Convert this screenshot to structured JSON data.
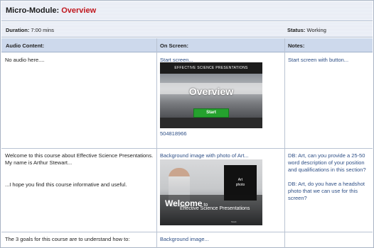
{
  "header": {
    "title_prefix": "Micro-Module: ",
    "title_highlight": "Overview",
    "duration_label": "Duration:",
    "duration_value": " 7:00 mins",
    "status_label": "Status:",
    "status_value": " Working"
  },
  "columns": {
    "audio": "Audio Content:",
    "screen": "On Screen:",
    "notes": "Notes:"
  },
  "rows": [
    {
      "audio": "No audio here....",
      "screen": "Start screen...",
      "screen_id": "504818966",
      "notes": "Start screen with button...",
      "thumb": {
        "band_text": "EFFECTIVE SCIENCE PRESENTATIONS",
        "big_text": "Overview",
        "button_text": "Start"
      }
    },
    {
      "audio_line1": "Welcome to this course about Effective Science Presentations.",
      "audio_line2": "My name is Arthur Stewart...",
      "audio_line3": "...I hope you find this course informative and useful.",
      "screen": "Background image with photo of Art...",
      "notes_line1": "DB: Art, can you provide a 25-50 word description of your position and qualifications in this section?",
      "notes_line2": "DB: Art, do you have a headshot photo that we can use for this screen?",
      "thumb": {
        "photo_label_1": "Art",
        "photo_label_2": "photo",
        "welcome": "Welcome",
        "welcome_to": " to",
        "subtitle": "Effective Science Presentations",
        "fine_print": "Stock"
      }
    },
    {
      "audio": "The 3 goals for this course are to understand how to:",
      "screen": "Background image...",
      "notes": ""
    }
  ]
}
